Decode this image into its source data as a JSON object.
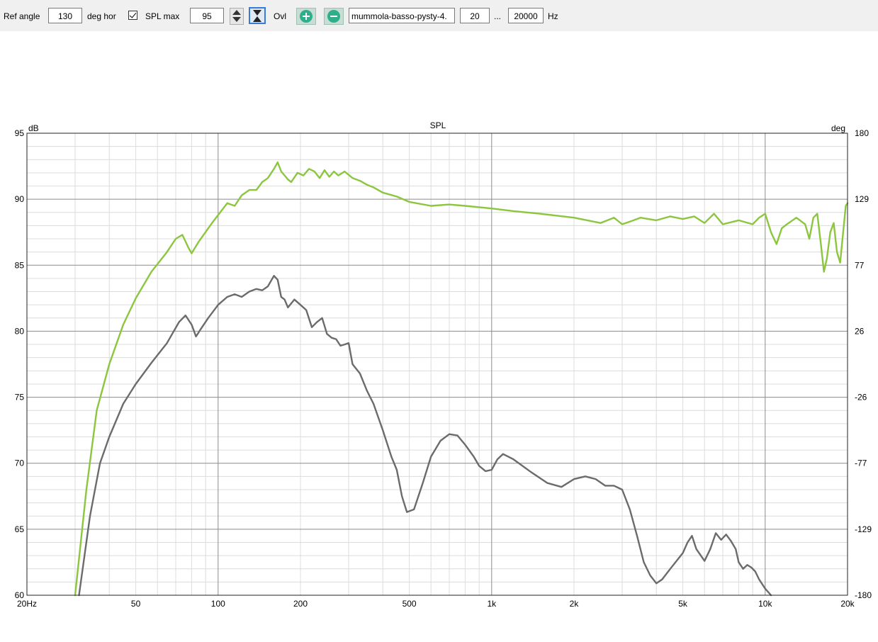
{
  "toolbar": {
    "ref_angle_label": "Ref angle",
    "ref_angle_value": "130",
    "deg_hor_label": "deg hor",
    "spl_max_checkbox_label": "SPL max",
    "spl_max_checked": true,
    "spl_max_value": "95",
    "ovl_label": "Ovl",
    "file_name": "mummola-basso-pysty-4.",
    "freq_min": "20",
    "range_separator": "...",
    "freq_max": "20000",
    "hz_label": "Hz",
    "add_icon": "plus-circle-icon",
    "remove_icon": "minus-circle-icon",
    "spin_icon": "up-down-arrows-icon",
    "fit_icon": "fit-vertical-icon"
  },
  "chart_data": {
    "type": "line",
    "title": "SPL",
    "ylabel": "dB",
    "y2label": "deg",
    "xscale": "log",
    "xlim": [
      20,
      20000
    ],
    "ylim": [
      60,
      95
    ],
    "y2lim": [
      -180,
      180
    ],
    "x_ticks": [
      {
        "value": 20,
        "label": "20Hz"
      },
      {
        "value": 50,
        "label": "50"
      },
      {
        "value": 100,
        "label": "100"
      },
      {
        "value": 200,
        "label": "200"
      },
      {
        "value": 500,
        "label": "500"
      },
      {
        "value": 1000,
        "label": "1k"
      },
      {
        "value": 2000,
        "label": "2k"
      },
      {
        "value": 5000,
        "label": "5k"
      },
      {
        "value": 10000,
        "label": "10k"
      },
      {
        "value": 20000,
        "label": "20k"
      }
    ],
    "y_ticks": [
      95,
      90,
      85,
      80,
      75,
      70,
      65,
      60
    ],
    "y2_ticks": [
      "180",
      "129",
      "77",
      "26",
      "-26",
      "-77",
      "-129",
      "-180"
    ],
    "grid": true,
    "colors": {
      "series_green": "#8cc63f",
      "series_gray": "#6b6b6b",
      "grid_major": "#8c8c8c",
      "grid_minor": "#dcdcdc"
    },
    "series": [
      {
        "color": "#8cc63f",
        "points": [
          [
            30,
            60
          ],
          [
            33,
            68
          ],
          [
            36,
            74
          ],
          [
            40,
            77.5
          ],
          [
            45,
            80.5
          ],
          [
            50,
            82.5
          ],
          [
            57,
            84.5
          ],
          [
            65,
            86
          ],
          [
            70,
            87
          ],
          [
            74,
            87.3
          ],
          [
            78,
            86.3
          ],
          [
            80,
            85.9
          ],
          [
            85,
            86.8
          ],
          [
            95,
            88.2
          ],
          [
            100,
            88.8
          ],
          [
            108,
            89.7
          ],
          [
            115,
            89.5
          ],
          [
            122,
            90.3
          ],
          [
            130,
            90.7
          ],
          [
            138,
            90.7
          ],
          [
            145,
            91.3
          ],
          [
            152,
            91.6
          ],
          [
            160,
            92.3
          ],
          [
            165,
            92.8
          ],
          [
            170,
            92.1
          ],
          [
            175,
            91.8
          ],
          [
            180,
            91.5
          ],
          [
            185,
            91.3
          ],
          [
            195,
            92
          ],
          [
            205,
            91.8
          ],
          [
            215,
            92.3
          ],
          [
            225,
            92.1
          ],
          [
            235,
            91.6
          ],
          [
            245,
            92.2
          ],
          [
            255,
            91.7
          ],
          [
            265,
            92.1
          ],
          [
            275,
            91.8
          ],
          [
            290,
            92.1
          ],
          [
            310,
            91.6
          ],
          [
            330,
            91.4
          ],
          [
            350,
            91.1
          ],
          [
            370,
            90.9
          ],
          [
            400,
            90.5
          ],
          [
            450,
            90.2
          ],
          [
            500,
            89.8
          ],
          [
            600,
            89.5
          ],
          [
            700,
            89.6
          ],
          [
            800,
            89.5
          ],
          [
            1000,
            89.3
          ],
          [
            1200,
            89.1
          ],
          [
            1500,
            88.9
          ],
          [
            2000,
            88.6
          ],
          [
            2500,
            88.2
          ],
          [
            2800,
            88.6
          ],
          [
            3000,
            88.1
          ],
          [
            3200,
            88.3
          ],
          [
            3500,
            88.6
          ],
          [
            4000,
            88.4
          ],
          [
            4500,
            88.7
          ],
          [
            5000,
            88.5
          ],
          [
            5500,
            88.7
          ],
          [
            6000,
            88.2
          ],
          [
            6500,
            88.9
          ],
          [
            7000,
            88.1
          ],
          [
            8000,
            88.4
          ],
          [
            9000,
            88.1
          ],
          [
            9500,
            88.6
          ],
          [
            10000,
            88.9
          ],
          [
            10500,
            87.5
          ],
          [
            11000,
            86.6
          ],
          [
            11500,
            87.8
          ],
          [
            12000,
            88.1
          ],
          [
            13000,
            88.6
          ],
          [
            14000,
            88.1
          ],
          [
            14500,
            87
          ],
          [
            15000,
            88.6
          ],
          [
            15500,
            88.9
          ],
          [
            16000,
            86.5
          ],
          [
            16400,
            84.5
          ],
          [
            16800,
            85.5
          ],
          [
            17300,
            87.5
          ],
          [
            17800,
            88.2
          ],
          [
            18300,
            86
          ],
          [
            18800,
            85.2
          ],
          [
            19300,
            87.6
          ],
          [
            19700,
            89.5
          ],
          [
            20000,
            89.7
          ]
        ]
      },
      {
        "color": "#6b6b6b",
        "points": [
          [
            31,
            60
          ],
          [
            34,
            66
          ],
          [
            37,
            70
          ],
          [
            40,
            72
          ],
          [
            45,
            74.5
          ],
          [
            50,
            76
          ],
          [
            57,
            77.6
          ],
          [
            65,
            79.1
          ],
          [
            72,
            80.7
          ],
          [
            76,
            81.2
          ],
          [
            80,
            80.5
          ],
          [
            83,
            79.6
          ],
          [
            86,
            80.1
          ],
          [
            92,
            81
          ],
          [
            100,
            82
          ],
          [
            108,
            82.6
          ],
          [
            115,
            82.8
          ],
          [
            122,
            82.6
          ],
          [
            130,
            83
          ],
          [
            138,
            83.2
          ],
          [
            145,
            83.1
          ],
          [
            152,
            83.4
          ],
          [
            160,
            84.2
          ],
          [
            165,
            83.9
          ],
          [
            170,
            82.6
          ],
          [
            175,
            82.4
          ],
          [
            180,
            81.8
          ],
          [
            190,
            82.4
          ],
          [
            200,
            82
          ],
          [
            210,
            81.6
          ],
          [
            220,
            80.3
          ],
          [
            230,
            80.7
          ],
          [
            240,
            81
          ],
          [
            250,
            79.8
          ],
          [
            260,
            79.5
          ],
          [
            270,
            79.4
          ],
          [
            280,
            78.9
          ],
          [
            290,
            79
          ],
          [
            300,
            79.1
          ],
          [
            310,
            77.5
          ],
          [
            330,
            76.8
          ],
          [
            350,
            75.5
          ],
          [
            370,
            74.5
          ],
          [
            400,
            72.5
          ],
          [
            430,
            70.5
          ],
          [
            450,
            69.5
          ],
          [
            470,
            67.5
          ],
          [
            490,
            66.3
          ],
          [
            520,
            66.5
          ],
          [
            560,
            68.5
          ],
          [
            600,
            70.5
          ],
          [
            650,
            71.7
          ],
          [
            700,
            72.2
          ],
          [
            750,
            72.1
          ],
          [
            800,
            71.4
          ],
          [
            860,
            70.5
          ],
          [
            900,
            69.8
          ],
          [
            950,
            69.4
          ],
          [
            1000,
            69.5
          ],
          [
            1050,
            70.3
          ],
          [
            1100,
            70.7
          ],
          [
            1200,
            70.3
          ],
          [
            1400,
            69.3
          ],
          [
            1600,
            68.5
          ],
          [
            1800,
            68.2
          ],
          [
            2000,
            68.8
          ],
          [
            2200,
            69
          ],
          [
            2400,
            68.8
          ],
          [
            2600,
            68.3
          ],
          [
            2800,
            68.3
          ],
          [
            3000,
            68
          ],
          [
            3200,
            66.5
          ],
          [
            3400,
            64.5
          ],
          [
            3600,
            62.5
          ],
          [
            3800,
            61.5
          ],
          [
            4000,
            60.9
          ],
          [
            4200,
            61.2
          ],
          [
            4500,
            62
          ],
          [
            5000,
            63.2
          ],
          [
            5200,
            64
          ],
          [
            5400,
            64.5
          ],
          [
            5600,
            63.5
          ],
          [
            6000,
            62.6
          ],
          [
            6300,
            63.5
          ],
          [
            6600,
            64.7
          ],
          [
            6900,
            64.2
          ],
          [
            7200,
            64.6
          ],
          [
            7500,
            64.1
          ],
          [
            7800,
            63.5
          ],
          [
            8000,
            62.5
          ],
          [
            8300,
            62
          ],
          [
            8600,
            62.3
          ],
          [
            8900,
            62.1
          ],
          [
            9200,
            61.8
          ],
          [
            9500,
            61.2
          ],
          [
            10000,
            60.5
          ],
          [
            10500,
            60
          ]
        ]
      }
    ]
  }
}
